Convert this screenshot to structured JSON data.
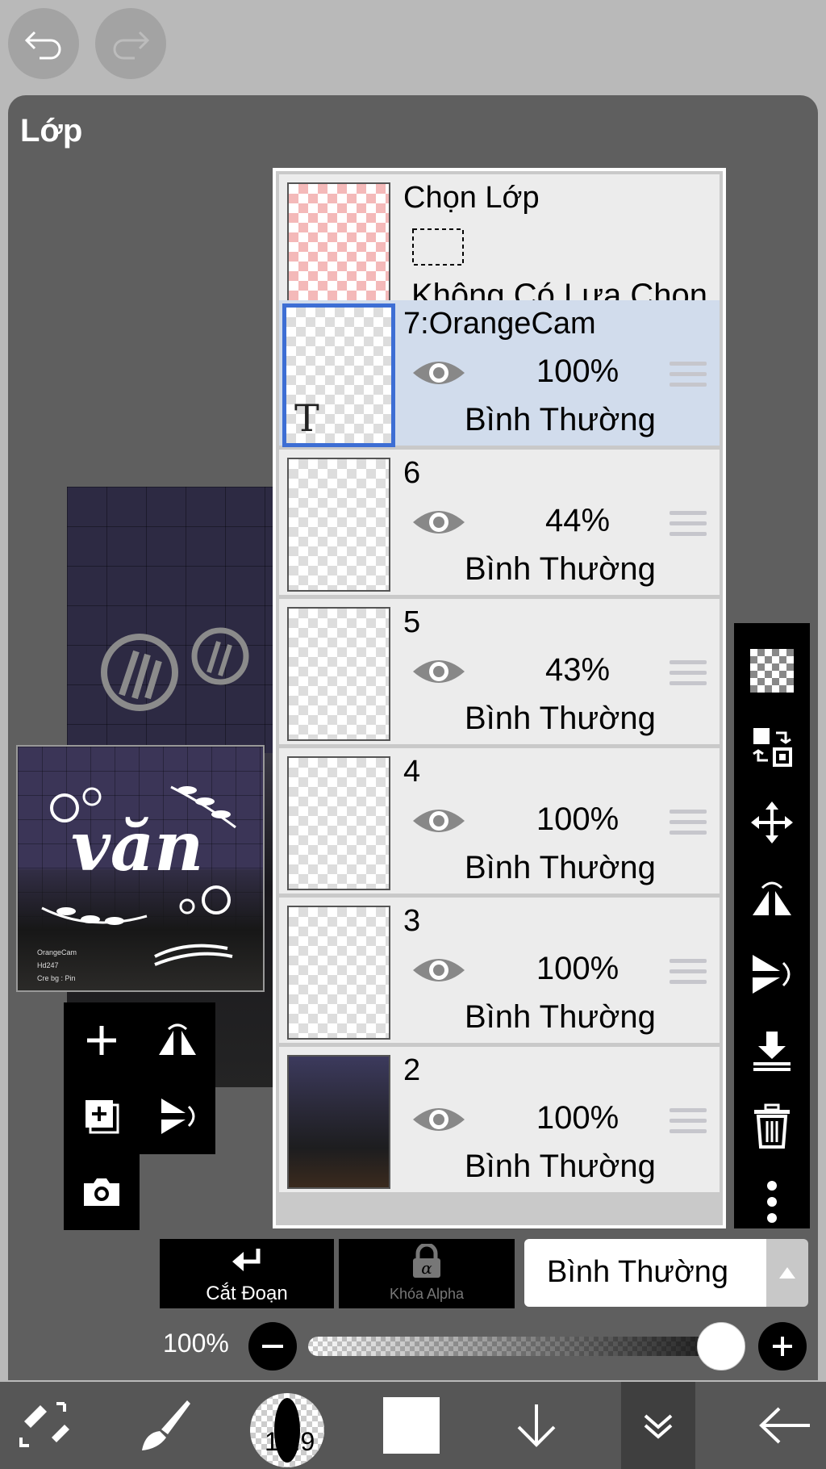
{
  "panel": {
    "title": "Lớp"
  },
  "selection_row": {
    "title": "Chọn Lớp",
    "status": "Không Có Lựa Chọn"
  },
  "layers": [
    {
      "name": "7:OrangeCam",
      "opacity": "100%",
      "blend": "Bình Thường",
      "selected": true,
      "thumb_glyph": "T"
    },
    {
      "name": "6",
      "opacity": "44%",
      "blend": "Bình Thường",
      "selected": false
    },
    {
      "name": "5",
      "opacity": "43%",
      "blend": "Bình Thường",
      "selected": false
    },
    {
      "name": "4",
      "opacity": "100%",
      "blend": "Bình Thường",
      "selected": false
    },
    {
      "name": "3",
      "opacity": "100%",
      "blend": "Bình Thường",
      "selected": false
    },
    {
      "name": "2",
      "opacity": "100%",
      "blend": "Bình Thường",
      "selected": false
    }
  ],
  "controls": {
    "clip_label": "Cắt Đoạn",
    "alpha_lock_label": "Khóa Alpha",
    "blend_mode": "Bình Thường",
    "opacity_label": "100%",
    "opacity_value": 1.0
  },
  "thumbnail": {
    "word": "văn",
    "credits": [
      "OrangeCam",
      "Hd247",
      "Cre bg : Pin"
    ]
  },
  "bottom_bar": {
    "brush_size": "18.9"
  },
  "colors": {
    "selection_blue": "#3d6ed4",
    "selected_row": "#d1dcec",
    "panel_bg": "#5f5f5f",
    "toolbar_bg": "#000000"
  }
}
